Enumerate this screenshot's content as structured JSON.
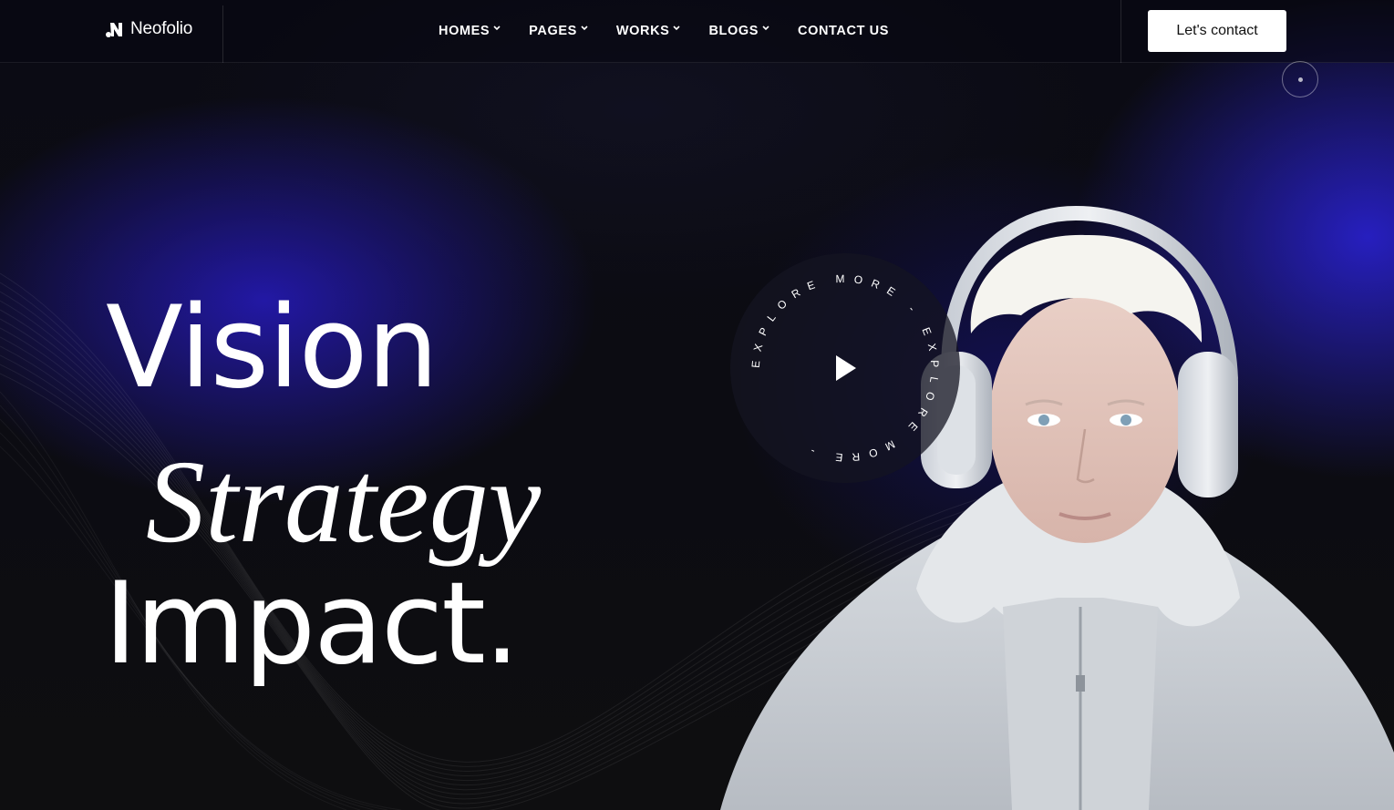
{
  "brand": {
    "name": "Neofolio"
  },
  "nav": {
    "items": [
      {
        "label": "HOMES",
        "has_dropdown": true
      },
      {
        "label": "PAGES",
        "has_dropdown": true
      },
      {
        "label": "WORKS",
        "has_dropdown": true
      },
      {
        "label": "BLOGS",
        "has_dropdown": true
      },
      {
        "label": "CONTACT US",
        "has_dropdown": false
      }
    ]
  },
  "header": {
    "cta_label": "Let's contact"
  },
  "hero": {
    "line1": "Vision",
    "line2": "Strategy",
    "line3": "Impact.",
    "explore_ring_text": "EXPLORE MORE - EXPLORE MORE -",
    "play_icon": "play-icon"
  },
  "colors": {
    "accent_blue": "#2a1fc6",
    "background": "#0c0c10",
    "cta_bg": "#ffffff",
    "cta_text": "#111111"
  }
}
